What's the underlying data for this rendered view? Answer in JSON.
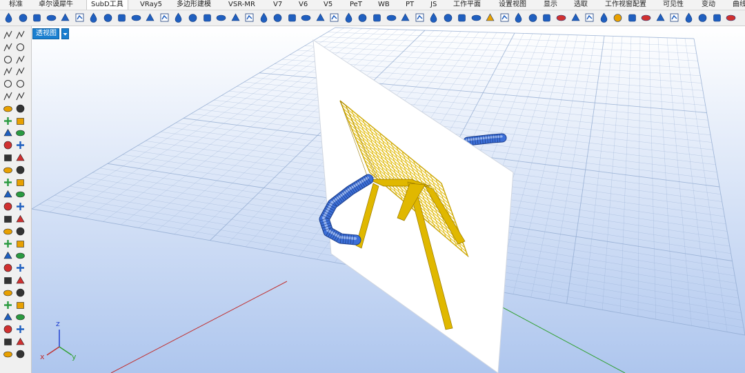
{
  "tabs": [
    {
      "label": "标准",
      "active": false
    },
    {
      "label": "卓尔谟犀牛",
      "active": false
    },
    {
      "label": "SubD工具",
      "active": true
    },
    {
      "label": "VRay5",
      "active": false
    },
    {
      "label": "多边形建模",
      "active": false
    },
    {
      "label": "VSR-MR",
      "active": false
    },
    {
      "label": "V7",
      "active": false
    },
    {
      "label": "V6",
      "active": false
    },
    {
      "label": "V5",
      "active": false
    },
    {
      "label": "PeT",
      "active": false
    },
    {
      "label": "WB",
      "active": false
    },
    {
      "label": "PT",
      "active": false
    },
    {
      "label": "JS",
      "active": false
    },
    {
      "label": "工作平面",
      "active": false
    },
    {
      "label": "设置视图",
      "active": false
    },
    {
      "label": "显示",
      "active": false
    },
    {
      "label": "选取",
      "active": false
    },
    {
      "label": "工作视窗配置",
      "active": false
    },
    {
      "label": "可见性",
      "active": false
    },
    {
      "label": "变动",
      "active": false
    },
    {
      "label": "曲线",
      "active": false
    }
  ],
  "toolbar": {
    "icons": [
      {
        "name": "subd-drop-icon",
        "color": "#1f5fbf"
      },
      {
        "name": "subd-cone-icon",
        "color": "#1f5fbf"
      },
      {
        "name": "subd-cylinder-icon",
        "color": "#1f5fbf"
      },
      {
        "name": "subd-box-icon",
        "color": "#1f5fbf"
      },
      {
        "name": "subd-sphere-icon",
        "color": "#1f5fbf"
      },
      {
        "name": "subd-ellipsoid-icon",
        "color": "#1f5fbf"
      },
      {
        "name": "subd-torus-icon",
        "color": "#1f5fbf"
      },
      {
        "name": "subd-capsule-icon",
        "color": "#1f5fbf"
      },
      {
        "name": "subd-plane-icon",
        "color": "#1f5fbf"
      },
      {
        "name": "subd-pipe-icon",
        "color": "#1f5fbf"
      },
      {
        "name": "subd-sweep-icon",
        "color": "#1f5fbf"
      },
      {
        "name": "subd-loft-icon",
        "color": "#1f5fbf"
      },
      {
        "name": "subd-revolve-icon",
        "color": "#1f5fbf"
      },
      {
        "name": "subd-patch-icon",
        "color": "#1f5fbf"
      },
      {
        "name": "subd-extrude-icon",
        "color": "#1f5fbf"
      },
      {
        "name": "subd-offset-icon",
        "color": "#1f5fbf"
      },
      {
        "name": "subd-bevel-icon",
        "color": "#1f5fbf"
      },
      {
        "name": "subd-bridge-icon",
        "color": "#1f5fbf"
      },
      {
        "name": "subd-append-icon",
        "color": "#1f5fbf"
      },
      {
        "name": "subd-fill-icon",
        "color": "#1f5fbf"
      },
      {
        "name": "subd-weld-icon",
        "color": "#1f5fbf"
      },
      {
        "name": "subd-unweld-icon",
        "color": "#1f5fbf"
      },
      {
        "name": "subd-crease-icon",
        "color": "#1f5fbf"
      },
      {
        "name": "subd-remove-crease-icon",
        "color": "#1f5fbf"
      },
      {
        "name": "subd-insert-edge-icon",
        "color": "#1f5fbf"
      },
      {
        "name": "subd-slide-icon",
        "color": "#1f5fbf"
      },
      {
        "name": "subd-stitch-icon",
        "color": "#1f5fbf"
      },
      {
        "name": "subd-symmetry-icon",
        "color": "#1f5fbf"
      },
      {
        "name": "subd-mirror-icon",
        "color": "#1f5fbf"
      },
      {
        "name": "subd-reflect-icon",
        "color": "#1f5fbf"
      },
      {
        "name": "subd-to-nurbs-icon",
        "color": "#1f5fbf"
      },
      {
        "name": "subd-from-mesh-icon",
        "color": "#1f5fbf"
      },
      {
        "name": "subd-quadremesh-icon",
        "color": "#1f5fbf"
      },
      {
        "name": "subd-box-mode-icon",
        "color": "#1f5fbf"
      },
      {
        "name": "subd-smooth-mode-icon",
        "color": "#e8a000"
      },
      {
        "name": "subd-display-icon",
        "color": "#1f5fbf"
      },
      {
        "name": "subd-select-faces-icon",
        "color": "#1f5fbf"
      },
      {
        "name": "subd-select-edges-icon",
        "color": "#1f5fbf"
      },
      {
        "name": "subd-select-vertices-icon",
        "color": "#1f5fbf"
      },
      {
        "name": "subd-gumball-icon",
        "color": "#d03030"
      },
      {
        "name": "subd-analyze-icon",
        "color": "#1f5fbf"
      },
      {
        "name": "subd-edit-icon",
        "color": "#1f5fbf"
      },
      {
        "name": "subd-sphere-alt-icon",
        "color": "#1f5fbf"
      },
      {
        "name": "subd-ring-icon",
        "color": "#e8a000"
      },
      {
        "name": "subd-loop-icon",
        "color": "#1f5fbf"
      },
      {
        "name": "subd-no-select-icon",
        "color": "#d03030"
      },
      {
        "name": "subd-tools-icon",
        "color": "#1f5fbf"
      },
      {
        "name": "subd-material-icon",
        "color": "#1f5fbf"
      },
      {
        "name": "subd-sculpt-icon",
        "color": "#1f5fbf"
      },
      {
        "name": "subd-grid-icon",
        "color": "#1f5fbf"
      },
      {
        "name": "subd-options-icon",
        "color": "#1f5fbf"
      },
      {
        "name": "subd-help-icon",
        "color": "#d03030"
      }
    ]
  },
  "sidebar": {
    "icons": [
      {
        "name": "select-arrow-icon"
      },
      {
        "name": "select-points-icon"
      },
      {
        "name": "polyline-icon"
      },
      {
        "name": "curve-points-icon"
      },
      {
        "name": "circle-icon"
      },
      {
        "name": "ellipse-icon"
      },
      {
        "name": "arc-icon"
      },
      {
        "name": "rectangle-icon"
      },
      {
        "name": "polygon-icon"
      },
      {
        "name": "freeform-curve-icon"
      },
      {
        "name": "fillet-curve-icon"
      },
      {
        "name": "offset-curve-icon"
      },
      {
        "name": "box-icon"
      },
      {
        "name": "sphere-icon"
      },
      {
        "name": "cylinder-icon"
      },
      {
        "name": "surface-icon"
      },
      {
        "name": "boolean-union-icon"
      },
      {
        "name": "extrude-icon"
      },
      {
        "name": "move-icon"
      },
      {
        "name": "copy-icon"
      },
      {
        "name": "split-icon"
      },
      {
        "name": "rotate-icon"
      },
      {
        "name": "trim-icon"
      },
      {
        "name": "scale-icon"
      },
      {
        "name": "join-icon"
      },
      {
        "name": "explode-icon"
      },
      {
        "name": "cage-edit-icon"
      },
      {
        "name": "flow-icon"
      },
      {
        "name": "array-icon"
      },
      {
        "name": "twist-icon"
      },
      {
        "name": "analyze-icon"
      },
      {
        "name": "check-icon"
      },
      {
        "name": "layer-icon"
      },
      {
        "name": "properties-icon"
      },
      {
        "name": "hide-icon"
      },
      {
        "name": "lock-icon"
      },
      {
        "name": "group-icon"
      },
      {
        "name": "block-icon"
      },
      {
        "name": "render-icon"
      },
      {
        "name": "material-icon"
      },
      {
        "name": "dimension-icon"
      },
      {
        "name": "text-icon"
      },
      {
        "name": "mesh-icon"
      },
      {
        "name": "mesh-edit-icon"
      },
      {
        "name": "sun-icon"
      },
      {
        "name": "camera-icon"
      },
      {
        "name": "save-icon"
      },
      {
        "name": "undo-icon"
      },
      {
        "name": "gumball-icon"
      },
      {
        "name": "osnap-icon"
      },
      {
        "name": "plugin-icon"
      },
      {
        "name": "macro-icon"
      },
      {
        "name": "curvature-icon"
      },
      {
        "name": "pen-icon"
      }
    ]
  },
  "viewport": {
    "label": "透视图",
    "background_top": "#ffffff",
    "background_bottom": "#aec6ee",
    "grid_color": "#8ea8cf",
    "axes": {
      "x": "x",
      "y": "y",
      "z": "z"
    },
    "colors": {
      "chair": "#e0b800",
      "chair_dark": "#9a7a00",
      "pipe": "#3c6fd8",
      "pipe_dark": "#1d3f8c",
      "picture_frame": "#ffffff",
      "x_axis": "#c03030",
      "y_axis": "#30a030",
      "z_axis": "#2040d0"
    }
  }
}
